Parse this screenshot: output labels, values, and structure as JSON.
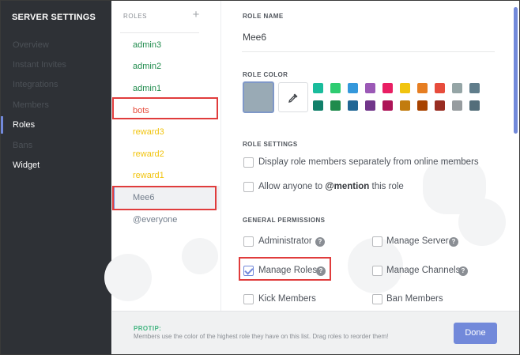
{
  "sidebar": {
    "title": "SERVER SETTINGS",
    "items": [
      {
        "label": "Overview"
      },
      {
        "label": "Instant Invites"
      },
      {
        "label": "Integrations"
      },
      {
        "label": "Members"
      },
      {
        "label": "Roles"
      },
      {
        "label": "Bans"
      },
      {
        "label": "Widget"
      }
    ]
  },
  "roles": {
    "header": "ROLES",
    "add_icon": "plus-icon",
    "items": [
      {
        "label": "admin3",
        "color": "#1f8b4c"
      },
      {
        "label": "admin2",
        "color": "#1f8b4c"
      },
      {
        "label": "admin1",
        "color": "#1f8b4c"
      },
      {
        "label": "bots",
        "color": "#e74c3c"
      },
      {
        "label": "reward3",
        "color": "#f1c40f"
      },
      {
        "label": "reward2",
        "color": "#f1c40f"
      },
      {
        "label": "reward1",
        "color": "#f1c40f"
      },
      {
        "label": "Mee6",
        "color": "#747f8d"
      },
      {
        "label": "@everyone",
        "color": "#747f8d"
      }
    ]
  },
  "role_name": {
    "label": "ROLE NAME",
    "value": "Mee6"
  },
  "role_color": {
    "label": "ROLE COLOR",
    "selected": "#99aab5",
    "picker_icon": "eyedropper-icon",
    "swatches_top": [
      "#1abc9c",
      "#2ecc71",
      "#3498db",
      "#9b59b6",
      "#e91e63",
      "#f1c40f",
      "#e67e22",
      "#e74c3c",
      "#95a5a6",
      "#607d8b"
    ],
    "swatches_bottom": [
      "#11806a",
      "#1f8b4c",
      "#206694",
      "#71368a",
      "#ad1457",
      "#c27c0e",
      "#a84300",
      "#992d22",
      "#979c9f",
      "#546e7a"
    ]
  },
  "role_settings": {
    "label": "ROLE SETTINGS",
    "options": [
      {
        "text": "Display role members separately from online members",
        "checked": false
      },
      {
        "pre": "Allow anyone to ",
        "bold": "@mention",
        "post": " this role",
        "checked": false
      }
    ]
  },
  "general_permissions": {
    "label": "GENERAL PERMISSIONS",
    "left": [
      {
        "text": "Administrator",
        "checked": false,
        "help": true
      },
      {
        "text": "Manage Roles",
        "checked": true,
        "help": true
      },
      {
        "text": "Kick Members",
        "checked": false,
        "help": false
      }
    ],
    "right": [
      {
        "text": "Manage Server",
        "checked": false,
        "help": true
      },
      {
        "text": "Manage Channels",
        "checked": false,
        "help": true
      },
      {
        "text": "Ban Members",
        "checked": false,
        "help": false
      }
    ],
    "help_glyph": "?"
  },
  "footer": {
    "protip_title": "PROTIP:",
    "protip_text": "Members use the color of the highest role they have on this list. Drag roles to reorder them!",
    "done_label": "Done"
  }
}
